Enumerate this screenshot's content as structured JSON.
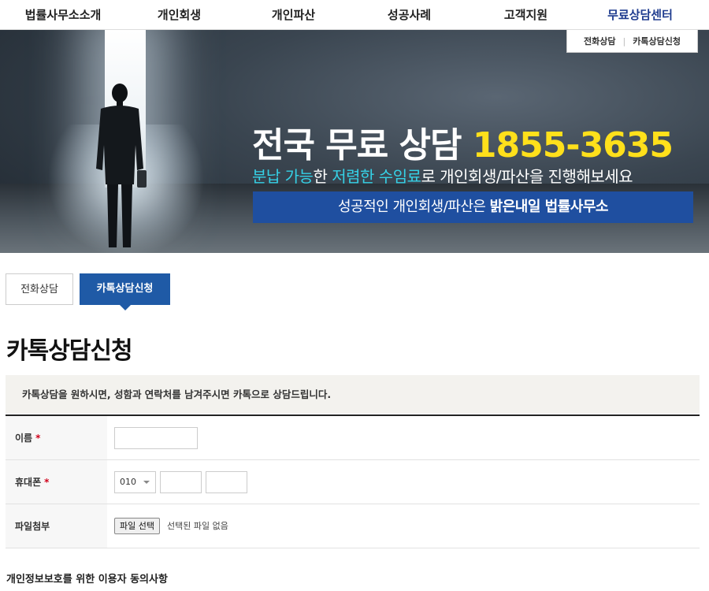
{
  "nav": {
    "items": [
      "법률사무소소개",
      "개인회생",
      "개인파산",
      "성공사례",
      "고객지원",
      "무료상담센터"
    ],
    "active_index": 5
  },
  "hero": {
    "sub_links": [
      "전화상담",
      "카톡상담신청"
    ],
    "title_prefix": "전국 무료 상담 ",
    "phone": "1855-3635",
    "subtitle": {
      "hl1": "분납 가능",
      "t1": "한 ",
      "hl2": "저렴한 수임료",
      "t2": "로 개인회생/파산을 진행해보세요"
    },
    "band": {
      "text": "성공적인 개인회생/파산은 ",
      "bold": "밝은내일 법률사무소"
    }
  },
  "tabs": {
    "phone": "전화상담",
    "kakao": "카톡상담신청",
    "active": "kakao"
  },
  "page_title": "카톡상담신청",
  "notice": "카톡상담을 원하시면, 성함과 연락처를 남겨주시면 카톡으로 상담드립니다.",
  "form": {
    "name_label": "이름",
    "phone_label": "휴대폰",
    "phone_prefix": "010",
    "file_label": "파일첨부",
    "file_button": "파일 선택",
    "file_status": "선택된 파일 없음",
    "required_mark": "*"
  },
  "privacy_title": "개인정보보호를 위한 이용자 동의사항",
  "colors": {
    "brand_blue": "#1f5aa6",
    "phone_yellow": "#ffe01b",
    "highlight_cyan": "#35d1e6",
    "required_red": "#d0021b"
  }
}
